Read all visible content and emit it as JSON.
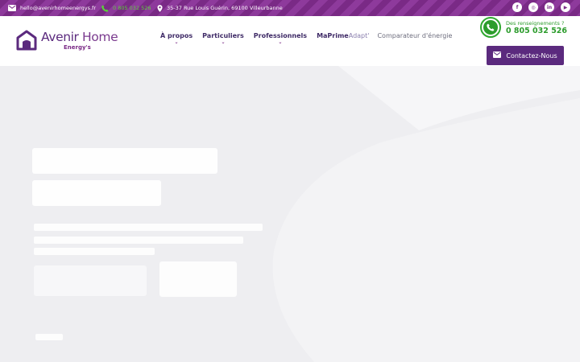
{
  "topbar": {
    "email": "hello@avenirhomeenergys.fr",
    "phone": "0 805 032 526",
    "address": "35-37 Rue Louis Guérin, 69100 Villeurbanne",
    "social": [
      {
        "icon": "facebook-icon",
        "glyph": "f"
      },
      {
        "icon": "instagram-icon",
        "glyph": "◎"
      },
      {
        "icon": "linkedin-icon",
        "glyph": "in"
      },
      {
        "icon": "youtube-icon",
        "glyph": "▶"
      }
    ]
  },
  "logo": {
    "main_a": "Avenir",
    "main_b": "Home",
    "sub": "Energy's"
  },
  "nav": {
    "items": [
      {
        "label": "À propos",
        "has_dropdown": true
      },
      {
        "label": "Particuliers",
        "has_dropdown": true
      },
      {
        "label": "Professionnels",
        "has_dropdown": true
      }
    ],
    "maprime_a": "MaPrime",
    "maprime_b": "Adapt'",
    "comparateur": "Comparateur d'énergie"
  },
  "contact": {
    "tel_label": "Des renseignements ?",
    "tel_number": "0 805 032 526",
    "button_label": "Contactez-Nous"
  },
  "colors": {
    "brand_purple": "#5b2a7e",
    "topbar_purple": "#7a2a86",
    "phone_green": "#2c9c2c"
  }
}
